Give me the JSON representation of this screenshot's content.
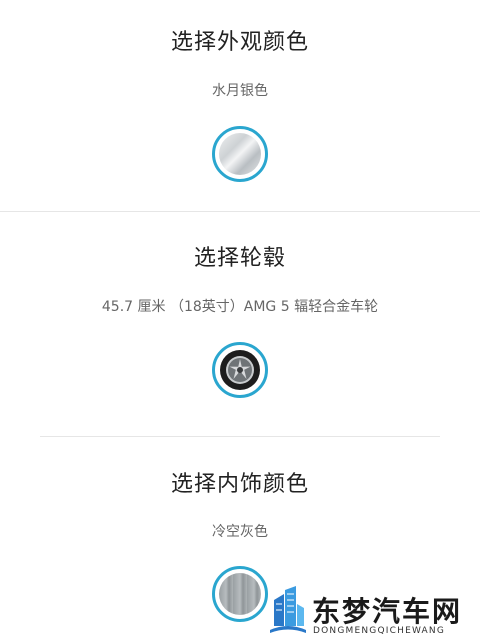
{
  "sections": [
    {
      "title": "选择外观颜色",
      "selected": "水月银色"
    },
    {
      "title": "选择轮毂",
      "selected": "45.7 厘米 （18英寸）AMG 5 辐轻合金车轮"
    },
    {
      "title": "选择内饰颜色",
      "selected": "冷空灰色"
    }
  ],
  "accent_color": "#2aa6cf",
  "watermark": {
    "name": "东梦汽车网",
    "domain": "DONGMENGQICHEWANG",
    "icon": "building-logo-icon"
  }
}
